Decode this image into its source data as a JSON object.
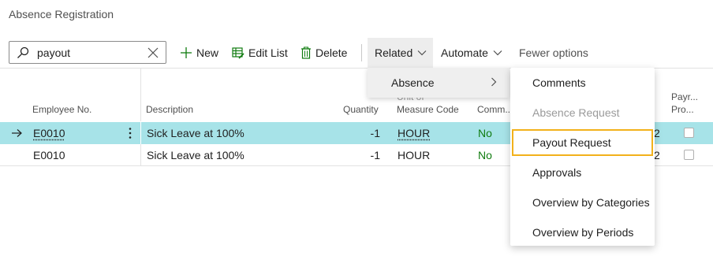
{
  "page": {
    "title": "Absence Registration"
  },
  "search": {
    "value": "payout"
  },
  "toolbar": {
    "new_label": "New",
    "edit_list_label": "Edit List",
    "delete_label": "Delete",
    "related_label": "Related",
    "automate_label": "Automate",
    "fewer_options_label": "Fewer options"
  },
  "columns": {
    "employee_no": "Employee No.",
    "description": "Description",
    "quantity": "Quantity",
    "uom_line1": "Unit of",
    "uom_line2": "Measure Code",
    "comment": "Comm...",
    "payroll_line1": "Payr...",
    "payroll_line2": "Pro..."
  },
  "rows": [
    {
      "employee_no": "E0010",
      "description": "Sick Leave at 100%",
      "quantity": "-1",
      "uom": "HOUR",
      "comment": "No",
      "hidden_tail": "2",
      "selected": true
    },
    {
      "employee_no": "E0010",
      "description": "Sick Leave at 100%",
      "quantity": "-1",
      "uom": "HOUR",
      "comment": "No",
      "hidden_tail": "2",
      "selected": false
    }
  ],
  "related_menu": {
    "submenu_label": "Absence",
    "items": [
      {
        "label": "Comments",
        "disabled": false
      },
      {
        "label": "Absence Request",
        "disabled": true
      },
      {
        "label": "Payout Request",
        "disabled": false,
        "focused": true
      },
      {
        "label": "Approvals",
        "disabled": false
      },
      {
        "label": "Overview by Categories",
        "disabled": false
      },
      {
        "label": "Overview by Periods",
        "disabled": false
      }
    ]
  },
  "colors": {
    "selected_row": "#a7e3e8",
    "focus_outline": "#f2b11b",
    "accent": "#107c10"
  },
  "icons": [
    "search-icon",
    "clear-icon",
    "plus-icon",
    "edit-list-icon",
    "trash-icon",
    "chevron-down-icon",
    "chevron-right-icon",
    "row-arrow-icon",
    "more-vertical-icon"
  ]
}
